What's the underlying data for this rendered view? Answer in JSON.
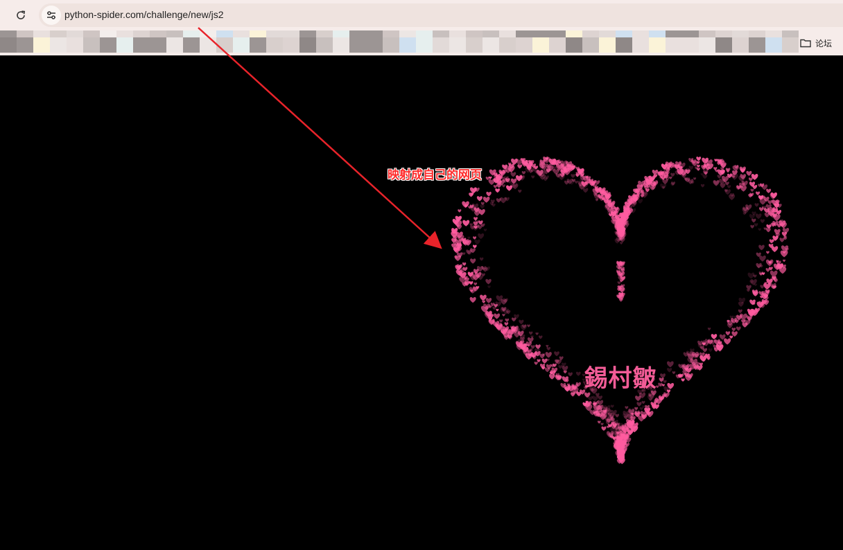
{
  "browser": {
    "url": "python-spider.com/challenge/new/js2",
    "bookmarks_folder_label": "论坛",
    "icons": {
      "reload": "reload-icon",
      "site_info": "site-settings-icon",
      "folder": "folder-icon"
    }
  },
  "page": {
    "background": "#000000",
    "center_text": "錫村皺",
    "annotation_text": "映射成自己的网页",
    "heart_color": "#ff5ca0",
    "annotation_color": "#ff2a2a"
  }
}
